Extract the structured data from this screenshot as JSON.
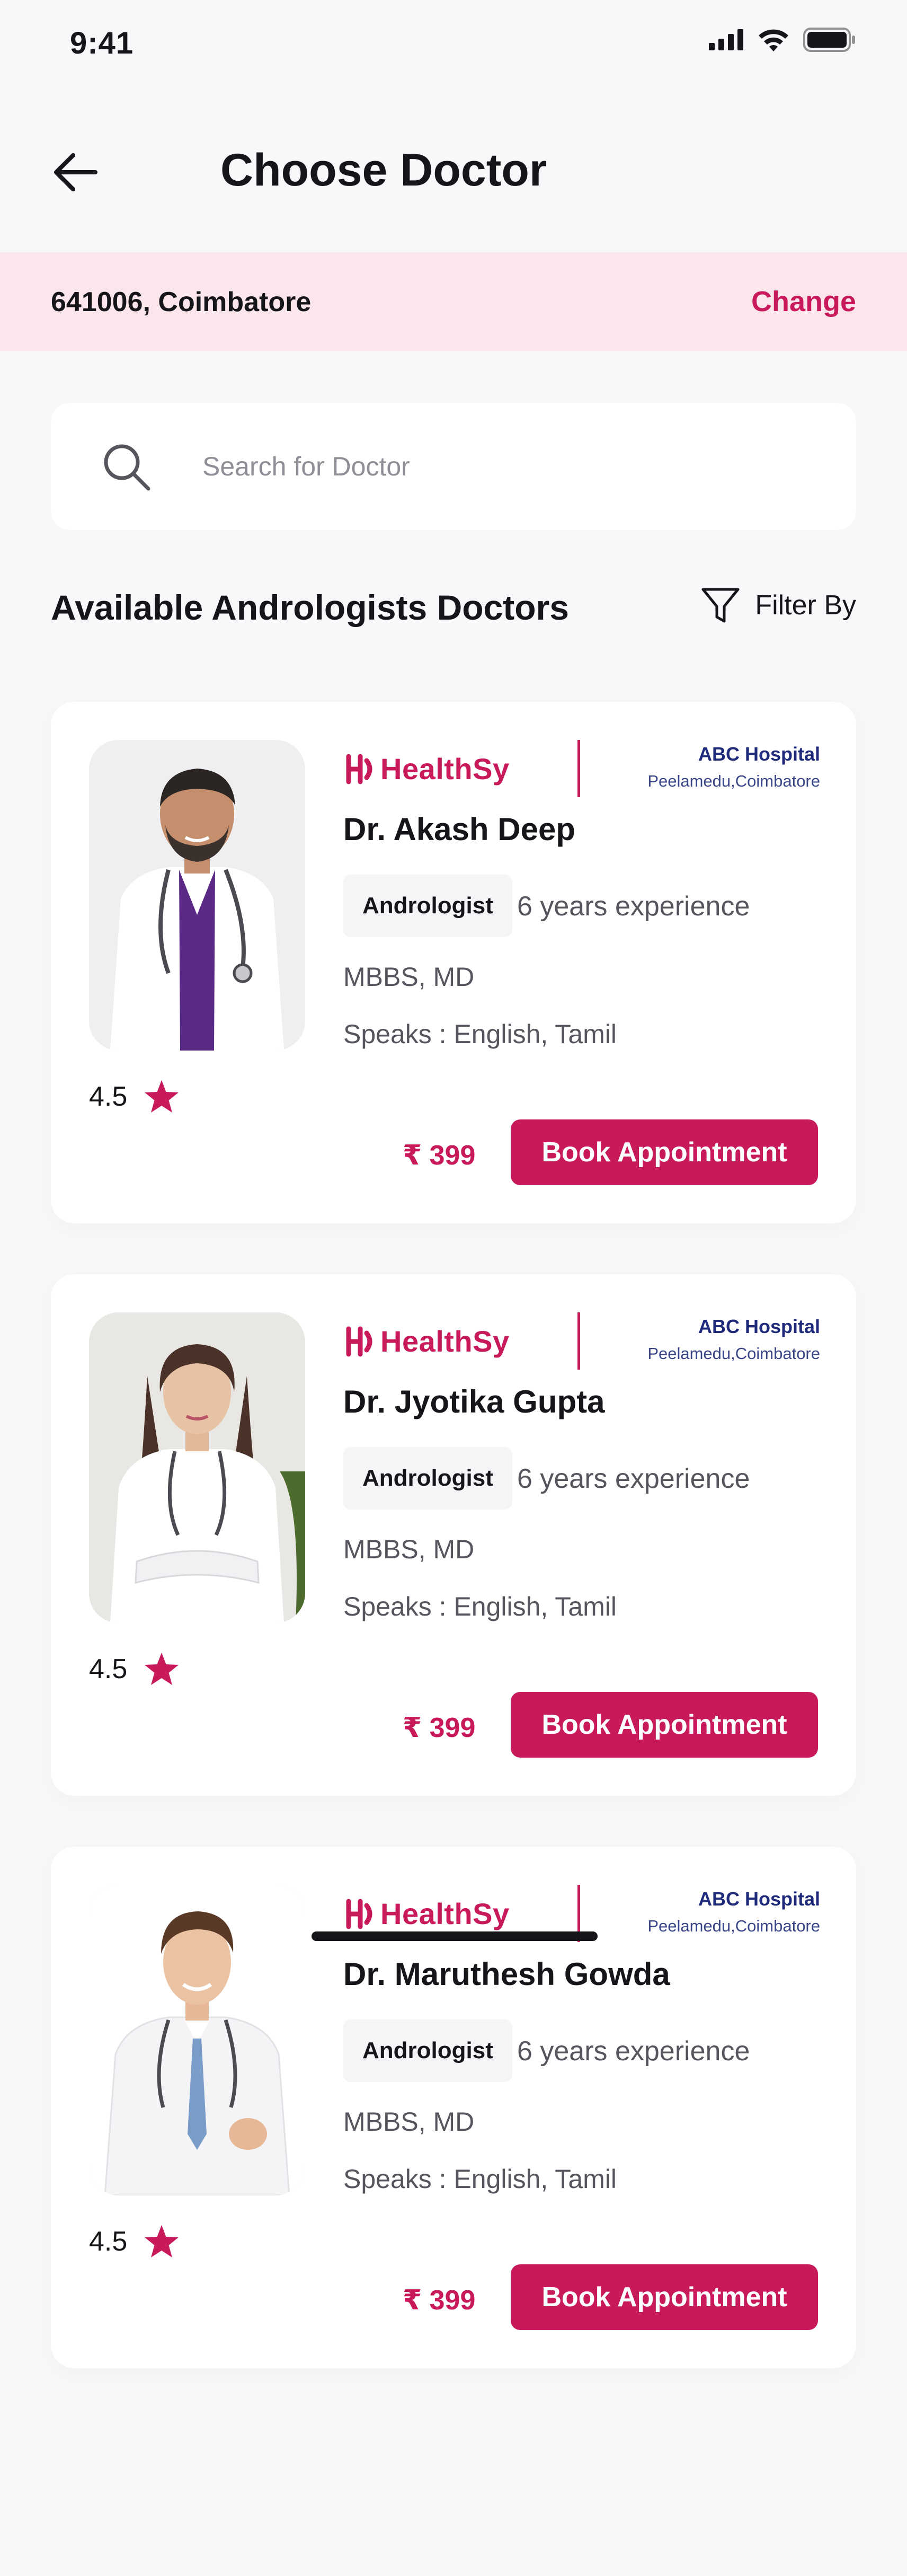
{
  "status_bar": {
    "time": "9:41"
  },
  "header": {
    "title": "Choose Doctor"
  },
  "location": {
    "text": "641006, Coimbatore",
    "change_label": "Change"
  },
  "search": {
    "placeholder": "Search for Doctor",
    "value": ""
  },
  "section": {
    "title": "Available Andrologists Doctors",
    "filter_label": "Filter By"
  },
  "doctors": [
    {
      "brand": "HealthSy",
      "hospital": "ABC Hospital",
      "hospital_location": "Peelamedu,Coimbatore",
      "name": "Dr. Akash Deep",
      "specialty": "Andrologist",
      "experience": "6 years experience",
      "qualification": "MBBS, MD",
      "languages": "Speaks : English, Tamil",
      "rating": "4.5",
      "price": "₹ 399",
      "book_label": "Book Appointment"
    },
    {
      "brand": "HealthSy",
      "hospital": "ABC Hospital",
      "hospital_location": "Peelamedu,Coimbatore",
      "name": "Dr. Jyotika Gupta",
      "specialty": "Andrologist",
      "experience": "6 years experience",
      "qualification": "MBBS, MD",
      "languages": "Speaks : English, Tamil",
      "rating": "4.5",
      "price": "₹ 399",
      "book_label": "Book Appointment"
    },
    {
      "brand": "HealthSy",
      "hospital": "ABC Hospital",
      "hospital_location": "Peelamedu,Coimbatore",
      "name": "Dr. Maruthesh Gowda",
      "specialty": "Andrologist",
      "experience": "6 years experience",
      "qualification": "MBBS, MD",
      "languages": "Speaks : English, Tamil",
      "rating": "4.5",
      "price": "₹ 399",
      "book_label": "Book Appointment"
    }
  ],
  "colors": {
    "accent": "#c8195b",
    "banner_bg": "#fbe6ec",
    "hospital_text": "#1f2a7a",
    "star": "#c8195b"
  },
  "icons": [
    "signal-icon",
    "wifi-icon",
    "battery-icon",
    "back-arrow-icon",
    "search-icon",
    "filter-icon",
    "healthsy-logo-icon",
    "star-icon"
  ]
}
